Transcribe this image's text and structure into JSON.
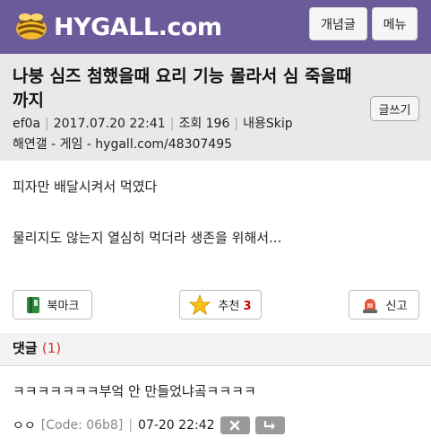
{
  "header": {
    "logo_text": "HYGALL.com",
    "concept_button": "개념글",
    "menu_button": "메뉴"
  },
  "post": {
    "title": "나붕 심즈 첨했을때 요리 기능 몰라서 심 죽을때까지",
    "write_button": "글쓰기",
    "author": "ef0a",
    "datetime": "2017.07.20 22:41",
    "views_label": "조회 196",
    "content_skip": "내용Skip",
    "board_path": "해연갤 - 게임 - hygall.com/48307495",
    "body_lines": [
      "피자만 배달시켜서 먹였다",
      "물리지도 않는지 열심히 먹더라 생존을 위해서..."
    ]
  },
  "actions": {
    "bookmark_label": "북마크",
    "recommend_label": "추천",
    "recommend_count": "3",
    "report_label": "신고"
  },
  "comments": {
    "label": "댓글",
    "count": "(1)",
    "items": [
      {
        "text": "ㅋㅋㅋㅋㅋㅋㅋ부엌 안 만들었냐곸ㅋㅋㅋㅋ",
        "author": "ㅇㅇ",
        "code": "[Code: 06b8]",
        "datetime": "07-20 22:42"
      }
    ]
  }
}
